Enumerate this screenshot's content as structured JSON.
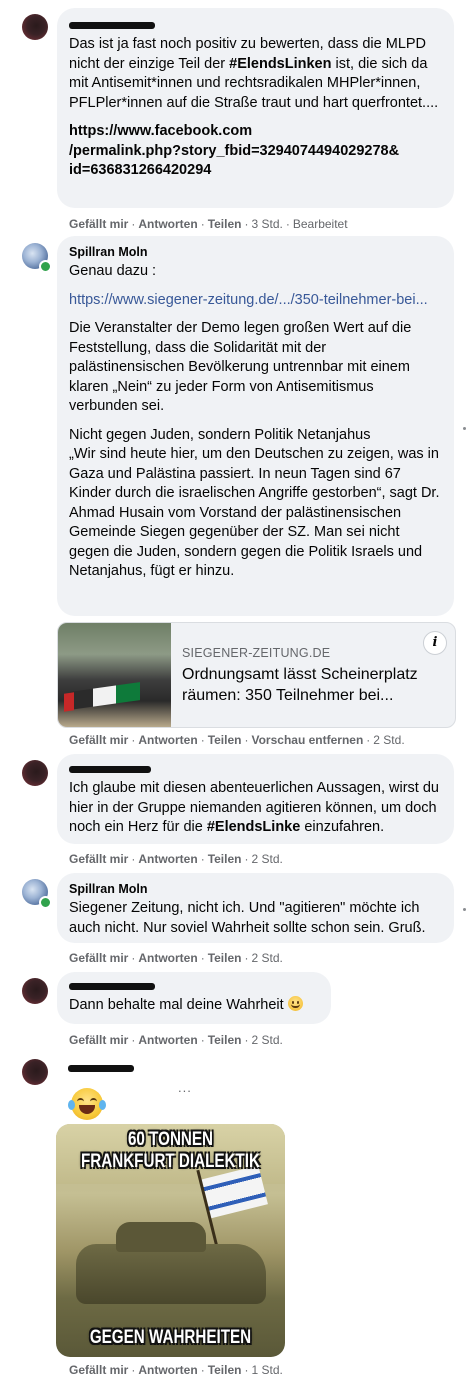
{
  "comments": [
    {
      "author": "",
      "paragraphs": [
        [
          {
            "t": "Das ist ja fast noch positiv zu bewerten, dass die MLPD nicht der einzige Teil der "
          },
          {
            "t": "#ElendsLinken",
            "b": true
          },
          {
            "t": " ist, die sich da mit Antisemit*innen und rechtsradikalen MHPler*innen, PFLPler*innen auf die Straße traut und hart querfrontet...."
          }
        ]
      ],
      "link_bold": "https://www.facebook.com\n/permalink.php?story_fbid=3294074494029278&\nid=636831266420294",
      "actions": [
        "Gefällt mir",
        "Antworten",
        "Teilen",
        "3 Std.",
        "Bearbeitet"
      ]
    },
    {
      "author": "Spillran Moln",
      "intro": "Genau dazu :",
      "link": "https://www.siegener-zeitung.de/.../350-teilnehmer-bei...",
      "p1": "Die Veranstalter der Demo legen großen Wert auf die Feststellung, dass die Solidarität mit der palästinensischen Bevölkerung untrennbar mit einem klaren „Nein“ zu jeder Form von Antisemitismus verbunden sei.",
      "p2": "Nicht gegen Juden, sondern Politik Netanjahus\n„Wir sind heute hier, um den Deutschen zu zeigen, was in Gaza und Palästina passiert. In neun Tagen sind 67 Kinder durch die israelischen Angriffe gestorben“, sagt Dr. Ahmad Husain vom Vorstand der palästinensischen Gemeinde Siegen gegenüber der SZ. Man sei nicht gegen die Juden, sondern gegen die Politik Israels und Netanjahus, fügt er hinzu.",
      "preview": {
        "domain": "SIEGENER-ZEITUNG.DE",
        "title": "Ordnungsamt lässt Scheinerplatz räumen: 350 Teilnehmer bei..."
      },
      "actions": [
        "Gefällt mir",
        "Antworten",
        "Teilen",
        "Vorschau entfernen",
        "2 Std."
      ]
    },
    {
      "author": "",
      "text_before": "Ich glaube mit diesen abenteuerlichen Aussagen, wirst du hier in der Gruppe niemanden agitieren können, um doch noch ein Herz für die ",
      "text_bold": "#ElendsLinke",
      "text_after": " einzufahren.",
      "actions": [
        "Gefällt mir",
        "Antworten",
        "Teilen",
        "2 Std."
      ]
    },
    {
      "author": "Spillran Moln",
      "text": "Siegener Zeitung, nicht ich. Und \"agitieren\" möchte ich auch nicht. Nur soviel Wahrheit sollte schon sein. Gruß.",
      "actions": [
        "Gefällt mir",
        "Antworten",
        "Teilen",
        "2 Std."
      ]
    },
    {
      "author": "",
      "text": "Dann behalte mal deine Wahrheit",
      "emoji": "smiling-face-emoji",
      "actions": [
        "Gefällt mir",
        "Antworten",
        "Teilen",
        "2 Std."
      ]
    },
    {
      "author": "",
      "emoji": "tears-of-joy-emoji",
      "more": "...",
      "meme": {
        "top1": "60 TONNEN",
        "top2": "FRANKFURT DIALEKTIK",
        "bottom": "GEGEN WAHRHEITEN"
      },
      "actions": [
        "Gefällt mir",
        "Antworten",
        "Teilen",
        "1 Std."
      ]
    }
  ],
  "colors": {
    "bubble": "#f0f2f5",
    "link": "#385898",
    "meta": "#65676b",
    "online": "#31a24c"
  }
}
